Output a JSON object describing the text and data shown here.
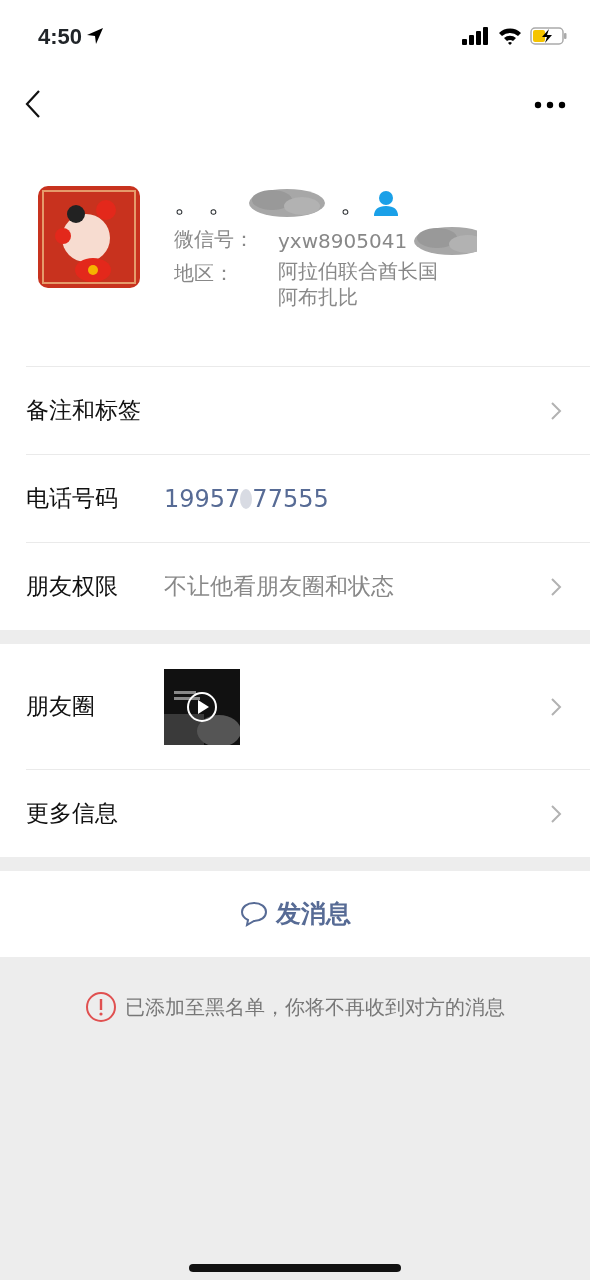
{
  "status_bar": {
    "time": "4:50"
  },
  "profile": {
    "name_start": "。 。",
    "name_end": "。",
    "fields": [
      {
        "label": "微信号：",
        "value": "yxw8905041",
        "redacted": true
      },
      {
        "label": "地区：",
        "value": "阿拉伯联合酋长国阿布扎比",
        "redacted": false
      }
    ]
  },
  "info_rows": [
    {
      "label": "备注和标签",
      "kind": "plain",
      "chevron": true
    },
    {
      "label": "电话号码",
      "kind": "phone",
      "value_start": "19957",
      "value_end": "77555",
      "chevron": false
    },
    {
      "label": "朋友权限",
      "kind": "text",
      "value": "不让他看朋友圈和状态",
      "chevron": true
    }
  ],
  "more_rows": [
    {
      "label": "朋友圈",
      "kind": "moments",
      "chevron": true
    },
    {
      "label": "更多信息",
      "kind": "plain",
      "chevron": true
    }
  ],
  "send_button": {
    "label": "发消息"
  },
  "notice": {
    "text": "已添加至黑名单，你将不再收到对方的消息"
  }
}
